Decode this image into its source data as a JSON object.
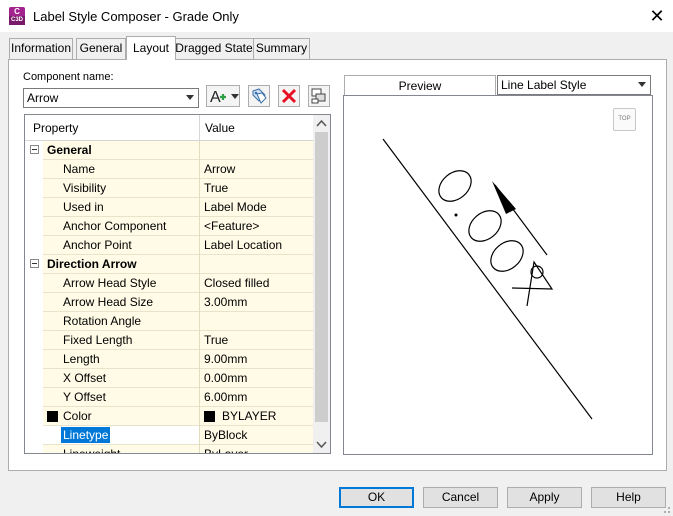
{
  "window": {
    "title": "Label Style Composer - Grade Only",
    "icon_text": "C",
    "icon_sub": "C3D",
    "close_icon": "✕"
  },
  "tabs": [
    {
      "label": "Information",
      "active": false
    },
    {
      "label": "General",
      "active": false
    },
    {
      "label": "Layout",
      "active": true
    },
    {
      "label": "Dragged State",
      "active": false
    },
    {
      "label": "Summary",
      "active": false
    }
  ],
  "component": {
    "label": "Component name:",
    "value": "Arrow"
  },
  "toolbar": {
    "add_icon": "add-component-icon",
    "copy_icon": "copy-component-icon",
    "delete_icon": "delete-component-icon",
    "draw_order_icon": "component-draw-order-icon"
  },
  "grid": {
    "col_property": "Property",
    "col_value": "Value",
    "rows": [
      {
        "type": "category",
        "name": "General"
      },
      {
        "type": "prop",
        "name": "Name",
        "value": "Arrow"
      },
      {
        "type": "prop",
        "name": "Visibility",
        "value": "True"
      },
      {
        "type": "prop",
        "name": "Used in",
        "value": "Label Mode"
      },
      {
        "type": "prop",
        "name": "Anchor Component",
        "value": "<Feature>"
      },
      {
        "type": "prop",
        "name": "Anchor Point",
        "value": "Label Location"
      },
      {
        "type": "category",
        "name": "Direction Arrow"
      },
      {
        "type": "prop",
        "name": "Arrow Head Style",
        "value": "Closed filled"
      },
      {
        "type": "prop",
        "name": "Arrow Head Size",
        "value": "3.00mm"
      },
      {
        "type": "prop",
        "name": "Rotation Angle",
        "value": ""
      },
      {
        "type": "prop",
        "name": "Fixed Length",
        "value": "True"
      },
      {
        "type": "prop",
        "name": "Length",
        "value": "9.00mm"
      },
      {
        "type": "prop",
        "name": "X Offset",
        "value": "0.00mm"
      },
      {
        "type": "prop",
        "name": "Y Offset",
        "value": "6.00mm"
      },
      {
        "type": "prop",
        "name": "Color",
        "value": "BYLAYER",
        "swatch": "#000000"
      },
      {
        "type": "prop",
        "name": "Linetype",
        "value": "ByBlock",
        "selected": true
      },
      {
        "type": "prop",
        "name": "Lineweight",
        "value": "ByLayer"
      }
    ]
  },
  "preview": {
    "tab_label": "Preview",
    "style_select": "Line Label Style",
    "view_badge": "TOP"
  },
  "buttons": {
    "ok": "OK",
    "cancel": "Cancel",
    "apply": "Apply",
    "help": "Help"
  },
  "colors": {
    "accent": "#0078d7",
    "grid_bg": "#fffbe6",
    "delete_red": "#e81123"
  }
}
